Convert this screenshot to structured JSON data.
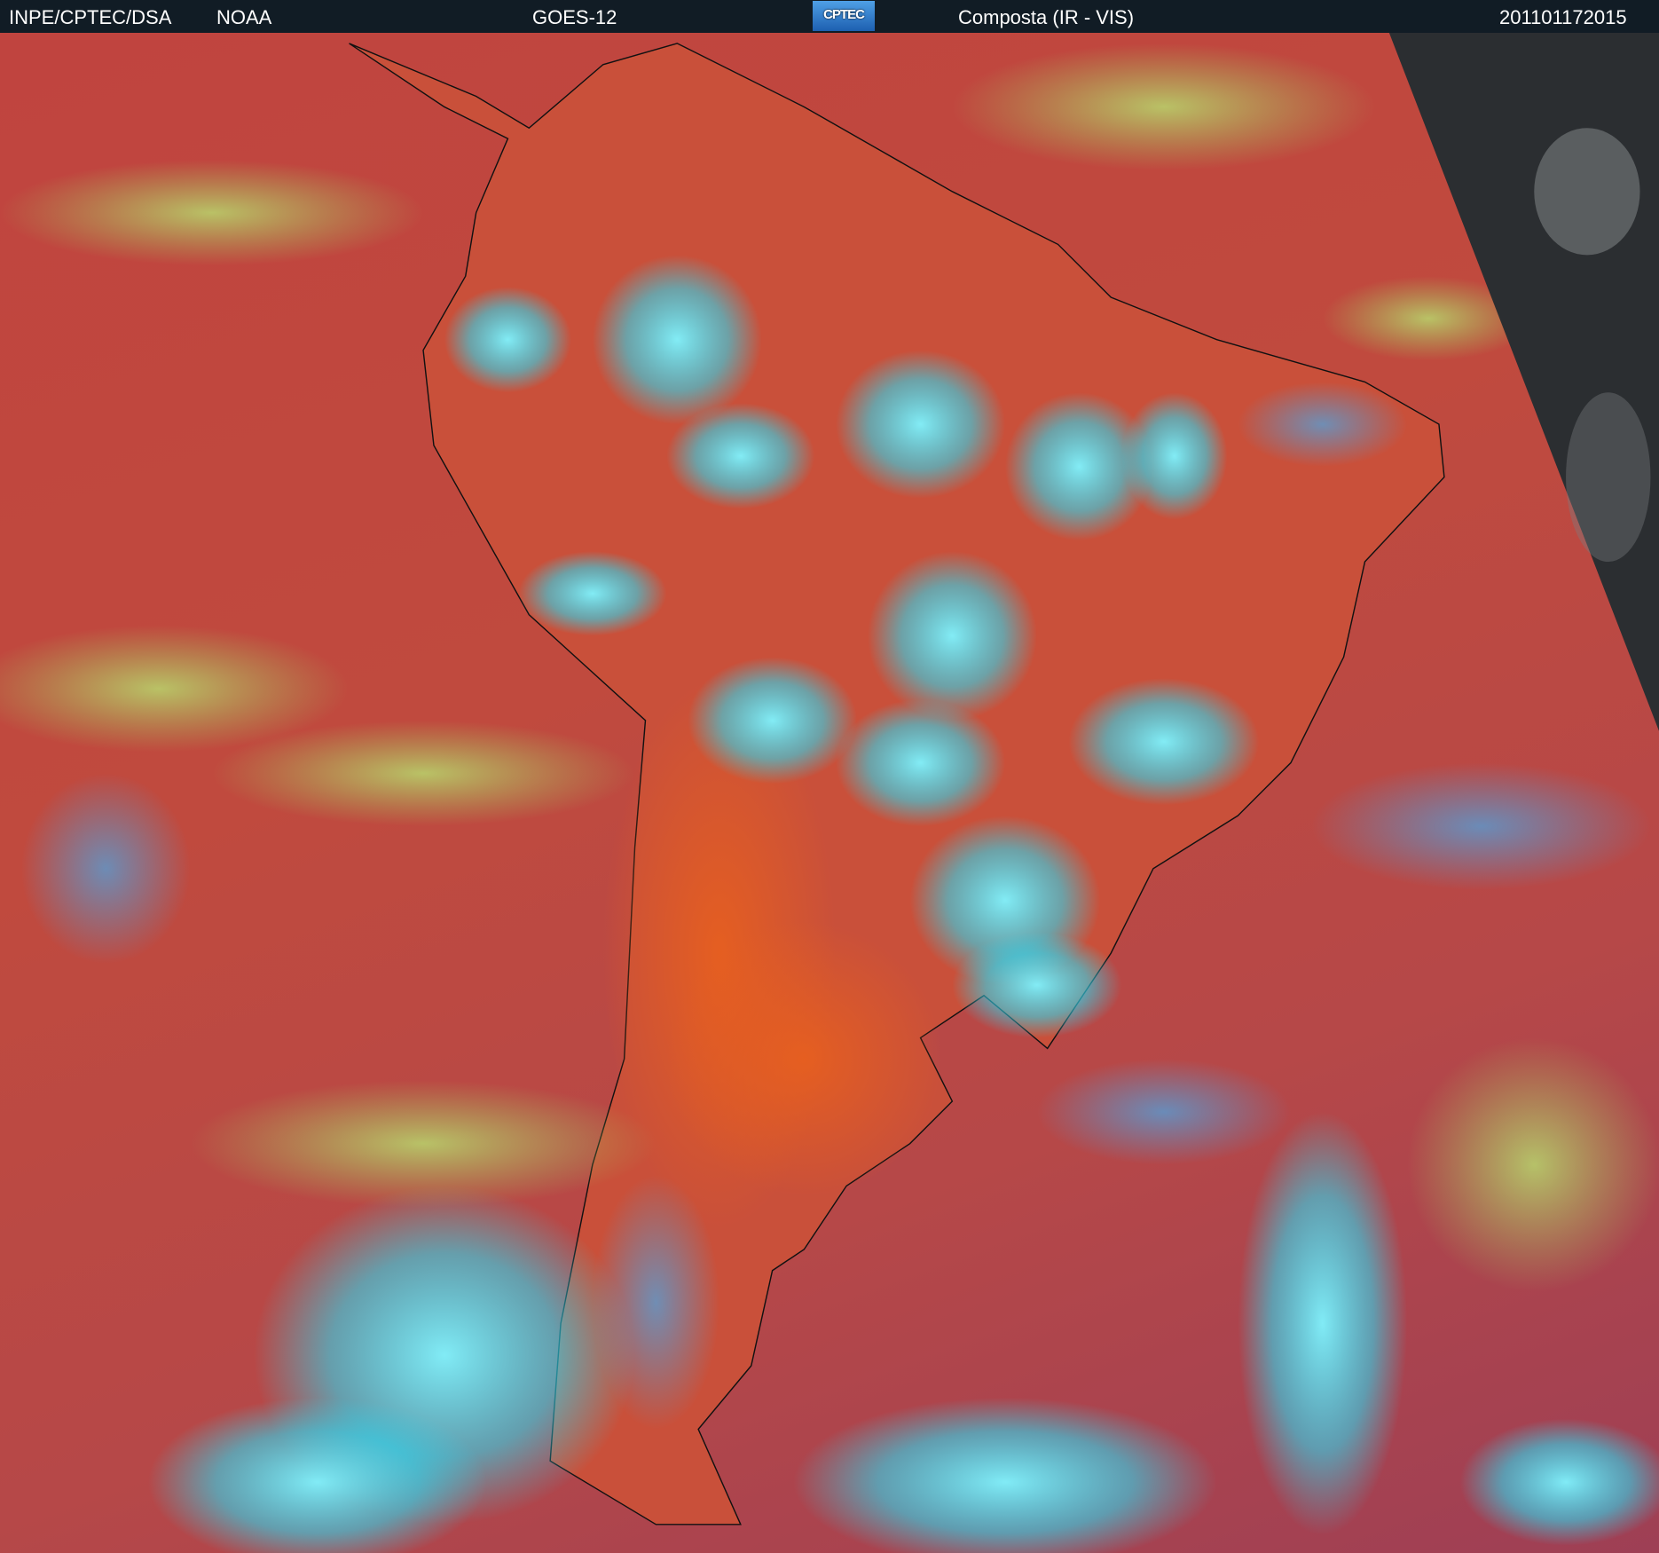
{
  "header": {
    "agency": "INPE/CPTEC/DSA",
    "source": "NOAA",
    "satellite": "GOES-12",
    "logo_text": "CPTEC",
    "product": "Composta (IR - VIS)",
    "timestamp": "201101172015"
  },
  "colors": {
    "header_bg": "#111c25",
    "ocean": "#c0443f",
    "land": "#d2553a",
    "cloud": "#35e6f5",
    "low_cloud": "#a8d860",
    "outside_disk": "#2a2d30"
  }
}
